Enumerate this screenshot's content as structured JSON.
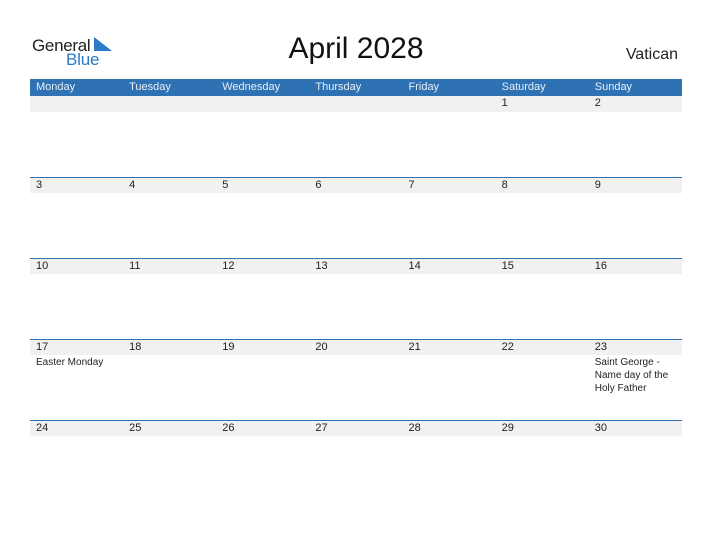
{
  "logo": {
    "general": "General",
    "blue": "Blue",
    "accent_color": "#2a7ac7"
  },
  "title": "April 2028",
  "country": "Vatican",
  "header_color": "#2f72b4",
  "weekdays": [
    "Monday",
    "Tuesday",
    "Wednesday",
    "Thursday",
    "Friday",
    "Saturday",
    "Sunday"
  ],
  "weeks": [
    {
      "days": [
        "",
        "",
        "",
        "",
        "",
        "1",
        "2"
      ],
      "events": [
        "",
        "",
        "",
        "",
        "",
        "",
        ""
      ]
    },
    {
      "days": [
        "3",
        "4",
        "5",
        "6",
        "7",
        "8",
        "9"
      ],
      "events": [
        "",
        "",
        "",
        "",
        "",
        "",
        ""
      ]
    },
    {
      "days": [
        "10",
        "11",
        "12",
        "13",
        "14",
        "15",
        "16"
      ],
      "events": [
        "",
        "",
        "",
        "",
        "",
        "",
        ""
      ]
    },
    {
      "days": [
        "17",
        "18",
        "19",
        "20",
        "21",
        "22",
        "23"
      ],
      "events": [
        "Easter Monday",
        "",
        "",
        "",
        "",
        "",
        "Saint George - Name day of the Holy Father"
      ]
    },
    {
      "days": [
        "24",
        "25",
        "26",
        "27",
        "28",
        "29",
        "30"
      ],
      "events": [
        "",
        "",
        "",
        "",
        "",
        "",
        ""
      ]
    }
  ]
}
